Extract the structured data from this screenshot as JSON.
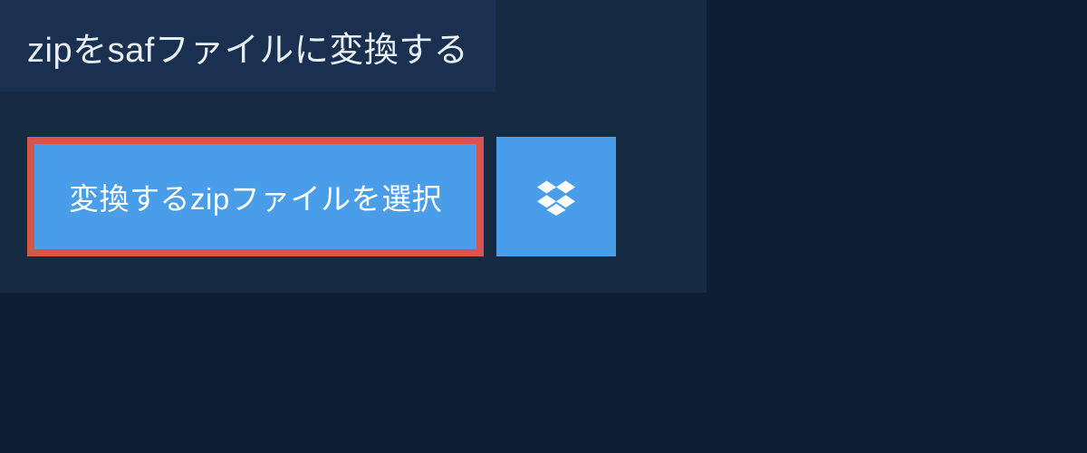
{
  "heading": "zipをsafファイルに変換する",
  "select_button_label": "変換するzipファイルを選択",
  "dropbox_icon_name": "dropbox-icon"
}
